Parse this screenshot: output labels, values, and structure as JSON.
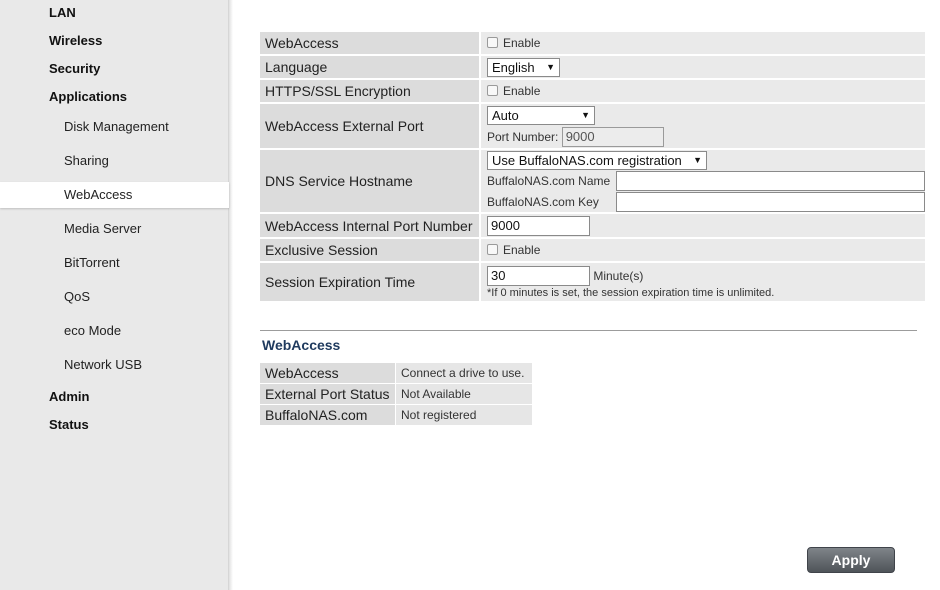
{
  "sidebar": {
    "top_items": [
      {
        "label": "LAN"
      },
      {
        "label": "Wireless"
      },
      {
        "label": "Security"
      },
      {
        "label": "Applications"
      }
    ],
    "sub_items": [
      {
        "label": "Disk Management"
      },
      {
        "label": "Sharing"
      },
      {
        "label": "WebAccess",
        "active": true
      },
      {
        "label": "Media Server"
      },
      {
        "label": "BitTorrent"
      },
      {
        "label": "QoS"
      },
      {
        "label": "eco Mode"
      },
      {
        "label": "Network USB"
      }
    ],
    "bottom_items": [
      {
        "label": "Admin"
      },
      {
        "label": "Status"
      }
    ]
  },
  "settings": {
    "webaccess": {
      "label": "WebAccess",
      "option": "Enable",
      "checked": false
    },
    "language": {
      "label": "Language",
      "value": "English"
    },
    "https": {
      "label": "HTTPS/SSL Encryption",
      "option": "Enable",
      "checked": false
    },
    "external_port": {
      "label": "WebAccess External Port",
      "mode": "Auto",
      "port_label": "Port Number:",
      "port_value": "9000"
    },
    "dns": {
      "label": "DNS Service Hostname",
      "mode": "Use BuffaloNAS.com registration",
      "name_label": "BuffaloNAS.com Name",
      "name_value": "",
      "key_label": "BuffaloNAS.com Key",
      "key_value": ""
    },
    "internal_port": {
      "label": "WebAccess Internal Port Number",
      "value": "9000"
    },
    "exclusive": {
      "label": "Exclusive Session",
      "option": "Enable",
      "checked": false
    },
    "expiration": {
      "label": "Session Expiration Time",
      "value": "30",
      "unit": "Minute(s)",
      "note": "*If 0 minutes is set, the session expiration time is unlimited."
    }
  },
  "status": {
    "title": "WebAccess",
    "rows": [
      {
        "label": "WebAccess",
        "value": "Connect a drive to use."
      },
      {
        "label": "External Port Status",
        "value": "Not Available"
      },
      {
        "label": "BuffaloNAS.com",
        "value": "Not registered"
      }
    ]
  },
  "apply_label": "Apply"
}
